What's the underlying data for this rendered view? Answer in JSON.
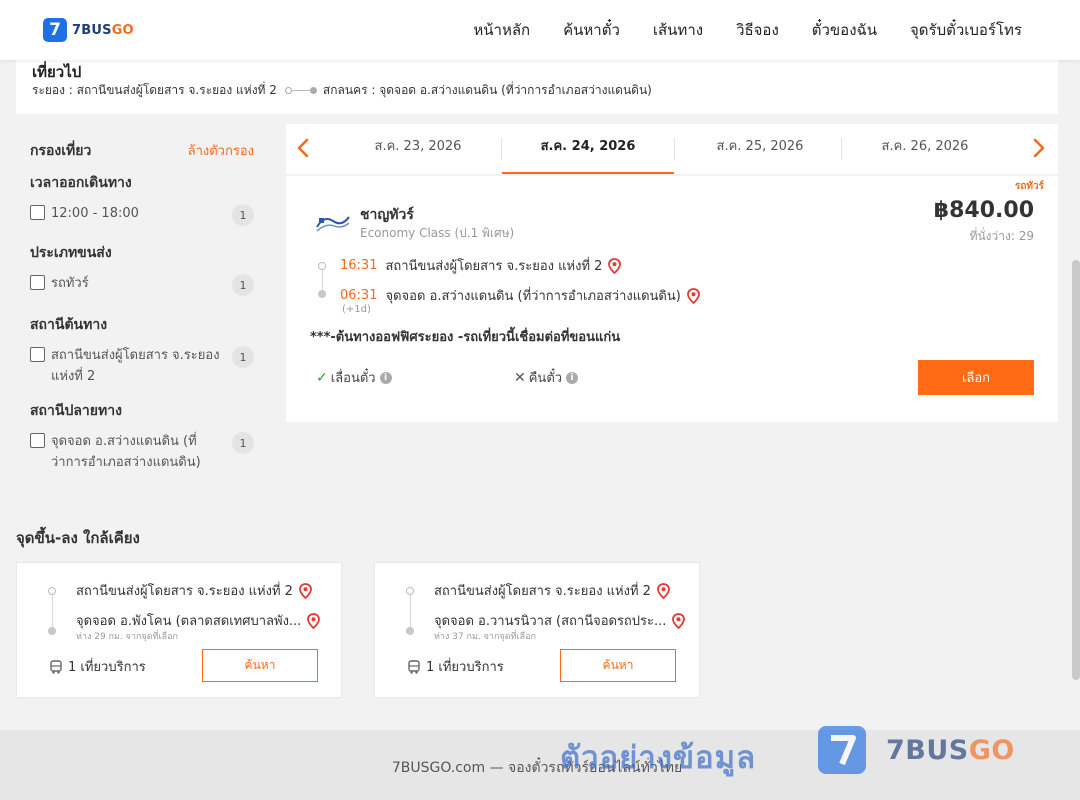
{
  "brand": {
    "badge": "7",
    "name_main": "7BUS",
    "name_accent": "GO"
  },
  "nav": [
    "หน้าหลัก",
    "ค้นหาตั๋ว",
    "เส้นทาง",
    "วิธีจอง",
    "ตั๋วของฉัน",
    "จุดรับตั๋วเบอร์โทร"
  ],
  "trip": {
    "title": "เที่ยวไป",
    "from": "ระยอง : สถานีขนส่งผู้โดยสาร จ.ระยอง แห่งที่ 2",
    "to": "สกลนคร : จุดจอด อ.สว่างแดนดิน (ที่ว่าการอำเภอสว่างแดนดิน)"
  },
  "filter": {
    "title": "กรองเที่ยว",
    "clear": "ล้างตัวกรอง",
    "groups": [
      {
        "title": "เวลาออกเดินทาง",
        "option": "12:00 - 18:00",
        "count": "1"
      },
      {
        "title": "ประเภทขนส่ง",
        "option": "รถทัวร์",
        "count": "1"
      },
      {
        "title": "สถานีต้นทาง",
        "option": "สถานีขนส่งผู้โดยสาร จ.ระยอง แห่งที่ 2",
        "count": "1"
      },
      {
        "title": "สถานีปลายทาง",
        "option": "จุดจอด อ.สว่างแดนดิน (ที่ว่าการอำเภอสว่างแดนดิน)",
        "count": "1"
      }
    ]
  },
  "dates": [
    "ส.ค. 23, 2026",
    "ส.ค. 24, 2026",
    "ส.ค. 25, 2026",
    "ส.ค. 26, 2026"
  ],
  "active_date_index": 1,
  "result": {
    "type": "รถทัวร์",
    "operator": "ชาญทัวร์",
    "class": "Economy Class (ป.1 พิเศษ)",
    "price": "฿840.00",
    "seats": "ที่นั่งว่าง: 29",
    "depart_time": "16:31",
    "depart_station": "สถานีขนส่งผู้โดยสาร จ.ระยอง แห่งที่ 2",
    "arrive_time": "06:31",
    "arrive_station": "จุดจอด อ.สว่างแดนดิน (ที่ว่าการอำเภอสว่างแดนดิน)",
    "next_day": "(+1d)",
    "note": "***-ต้นทางออฟฟิศระยอง -รถเที่ยวนี้เชื่อมต่อที่ขอนแก่น",
    "reschedule": "เลื่อนตั๋ว",
    "refund": "คืนตั๋ว",
    "select": "เลือก"
  },
  "nearby": {
    "title": "จุดขึ้น-ลง ใกล้เคียง",
    "cards": [
      {
        "from": "สถานีขนส่งผู้โดยสาร จ.ระยอง แห่งที่ 2",
        "to": "จุดจอด อ.พังโคน (ตลาดสดเทศบาลพัง...",
        "distance": "ห่าง 29 กม. จากจุดที่เลือก",
        "trips": "1 เที่ยวบริการ",
        "button": "ค้นหา"
      },
      {
        "from": "สถานีขนส่งผู้โดยสาร จ.ระยอง แห่งที่ 2",
        "to": "จุดจอด อ.วานรนิวาส (สถานีจอดรถประ...",
        "distance": "ห่าง 37 กม. จากจุดที่เลือก",
        "trips": "1 เที่ยวบริการ",
        "button": "ค้นหา"
      }
    ]
  },
  "footer": "7BUSGO.com — จองตั๋วรถทัวร์ออนไลน์ทั่วไทย",
  "watermark": "ตัวอย่างข้อมูล",
  "colors": {
    "accent": "#ff6a13",
    "brand": "#1f6fe5",
    "pin": "#e53935",
    "check": "#2e9d3a"
  }
}
